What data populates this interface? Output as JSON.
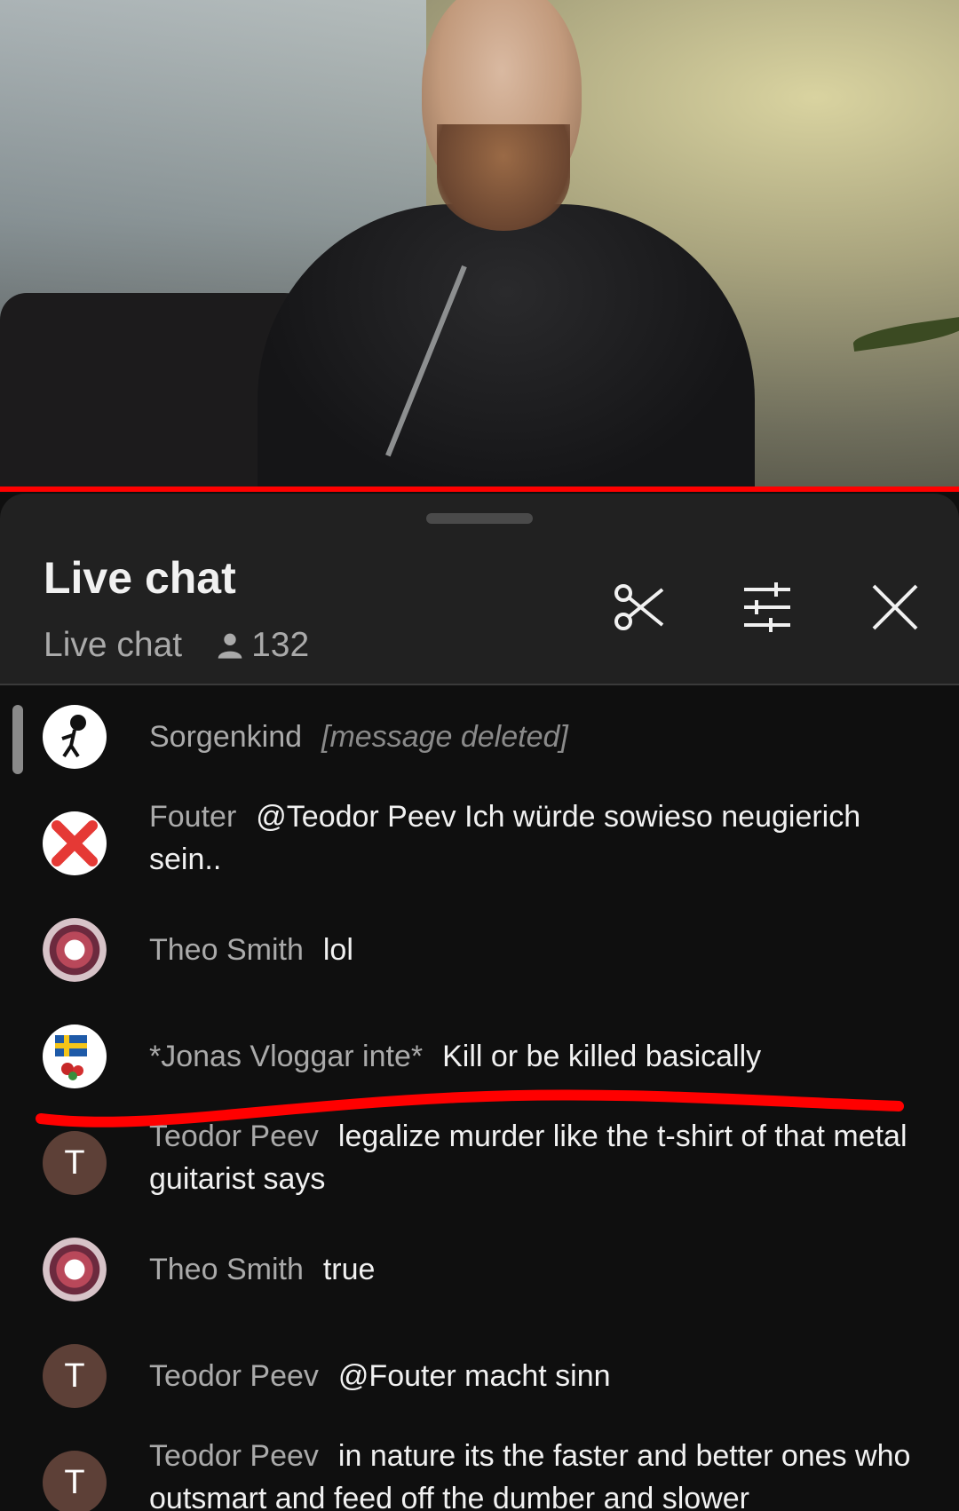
{
  "header": {
    "title": "Live chat",
    "subtitle": "Live chat",
    "viewer_count": "132",
    "icons": [
      "scissors-icon",
      "filter-icon",
      "close-icon"
    ]
  },
  "messages": [
    {
      "author": "Sorgenkind",
      "text": "[message deleted]",
      "deleted": true,
      "avatar": "figure-icon"
    },
    {
      "author": "Fouter",
      "text": "@Teodor Peev Ich würde sowieso neugierich sein..",
      "avatar": "red-x-icon"
    },
    {
      "author": "Theo Smith",
      "text": "lol",
      "avatar": "art-avatar"
    },
    {
      "author": "*Jonas Vloggar inte*",
      "text": "Kill or be killed basically",
      "avatar": "sweden-flag-icon"
    },
    {
      "author": "Teodor Peev",
      "text": "legalize murder like the t-shirt of that metal guitarist says",
      "avatar_letter": "T"
    },
    {
      "author": "Theo Smith",
      "text": "true",
      "avatar": "art-avatar"
    },
    {
      "author": "Teodor Peev",
      "text": "@Fouter macht sinn",
      "avatar_letter": "T"
    },
    {
      "author": "Teodor Peev",
      "text": "in nature its the faster and better ones who outsmart and feed off the dumber and slower",
      "avatar_letter": "T"
    }
  ],
  "colors": {
    "progress": "#ff0000",
    "annotation": "#ff0000",
    "letter_avatar": "#5d4037"
  }
}
